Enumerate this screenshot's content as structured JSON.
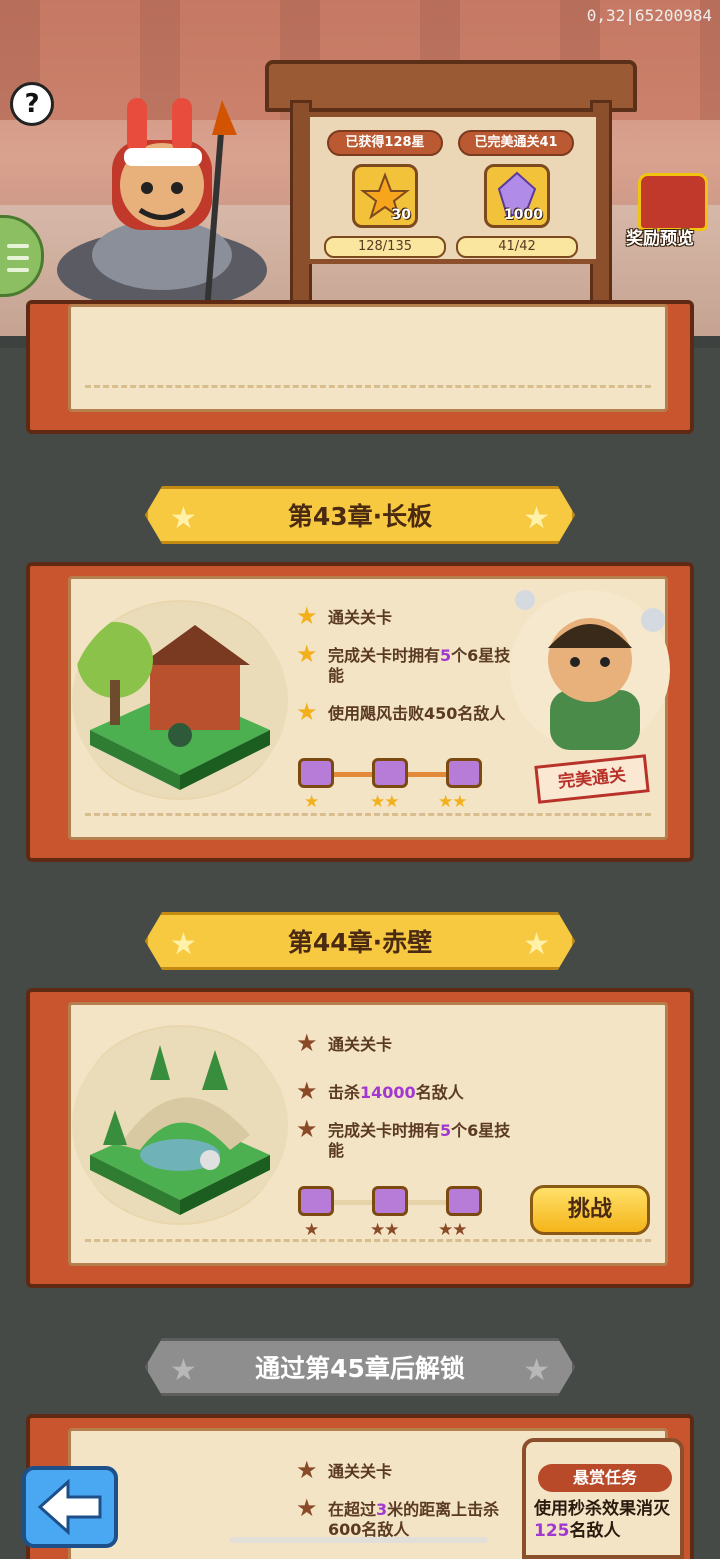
{
  "debug_id": "0,32|65200984",
  "header": {
    "help_label": "?",
    "stars_title": "已获得128星",
    "stars_icon_value": "30",
    "stars_progress": "128/135",
    "perfect_title": "已完美通关41",
    "perfect_icon_value": "1000",
    "perfect_progress": "41/42",
    "reward_preview": "奖励预览"
  },
  "chapters": [
    {
      "title": "第43章·长板",
      "tasks": [
        {
          "pre": "通关关卡",
          "hl": "",
          "post": ""
        },
        {
          "pre": "完成关卡时拥有",
          "hl": "5",
          "post": "个6星技能"
        },
        {
          "pre": "使用飓风击败450名敌人",
          "hl": "",
          "post": ""
        }
      ],
      "stamp": "完美通关",
      "chest_stars": [
        "★",
        "★★",
        "★★"
      ]
    },
    {
      "title": "第44章·赤壁",
      "tasks": [
        {
          "pre": "通关关卡",
          "hl": "",
          "post": ""
        },
        {
          "pre": "击杀",
          "hl": "14000",
          "post": "名敌人"
        },
        {
          "pre": "完成关卡时拥有",
          "hl": "5",
          "post": "个6星技能"
        }
      ],
      "action": "挑战",
      "chest_stars": [
        "★",
        "★★",
        "★★"
      ]
    },
    {
      "title": "通过第45章后解锁",
      "tasks": [
        {
          "pre": "通关关卡",
          "hl": "",
          "post": ""
        },
        {
          "pre": "在超过",
          "hl": "3",
          "post": "米的距离上击杀600名敌人"
        }
      ]
    }
  ],
  "bounty": {
    "title": "悬赏任务",
    "pre": "使用秒杀效果消灭",
    "hl": "125",
    "post": "名敌人"
  },
  "icons": {
    "star_earned": "star-gold",
    "star_unearned": "star-brown",
    "back": "back-arrow-icon"
  },
  "colors": {
    "highlight": "#a237d1",
    "banner_active": "#f7c940",
    "banner_locked": "#8e8e8e",
    "background": "#454a47"
  }
}
